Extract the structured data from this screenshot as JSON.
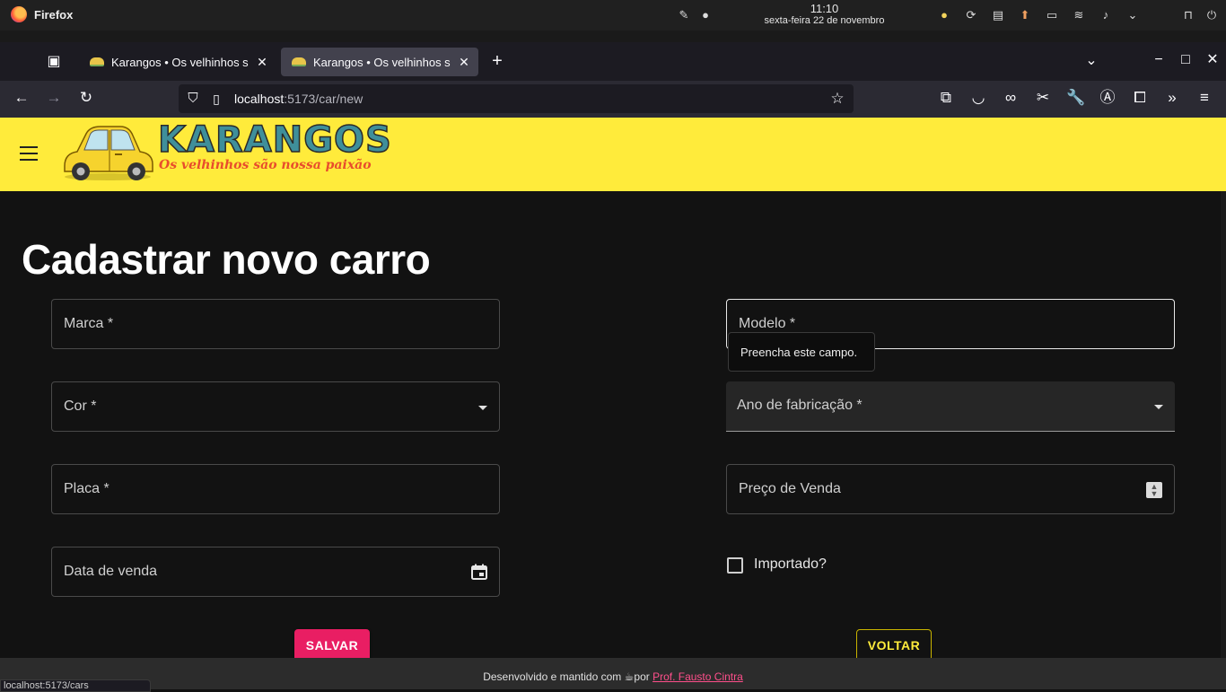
{
  "os": {
    "app_name": "Firefox",
    "time": "11:10",
    "date": "sexta-feira 22 de novembro",
    "tray_icons": [
      "weather-icon",
      "update-icon",
      "clipboard-icon",
      "upload-icon",
      "battery-icon",
      "wifi-icon",
      "volume-icon",
      "chevron-down-icon",
      "lock-icon",
      "power-icon"
    ]
  },
  "browser": {
    "tabs": [
      {
        "title": "Karangos • Os velhinhos s",
        "active": false
      },
      {
        "title": "Karangos • Os velhinhos s",
        "active": true
      }
    ],
    "url_host": "localhost",
    "url_path": ":5173/car/new",
    "status_url": "localhost:5173/cars"
  },
  "header": {
    "logo_title": "KARANGOS",
    "logo_tagline": "Os velhinhos são nossa paixão",
    "colors": {
      "background": "#ffeb3b"
    }
  },
  "form": {
    "title": "Cadastrar novo carro",
    "fields": {
      "marca": "Marca *",
      "cor": "Cor *",
      "placa": "Placa *",
      "data_venda": "Data de venda",
      "modelo": "Modelo *",
      "ano": "Ano de fabricação *",
      "preco": "Preço de Venda"
    },
    "validation_tooltip": "Preencha este campo.",
    "imported_label": "Importado?",
    "imported_checked": false,
    "save_label": "SALVAR",
    "back_label": "VOLTAR",
    "colors": {
      "save": "#e91e63",
      "back": "#ffeb3b"
    }
  },
  "footer": {
    "text_before": "Desenvolvido e mantido com",
    "text_mid": "por",
    "author": "Prof. Fausto Cintra"
  }
}
